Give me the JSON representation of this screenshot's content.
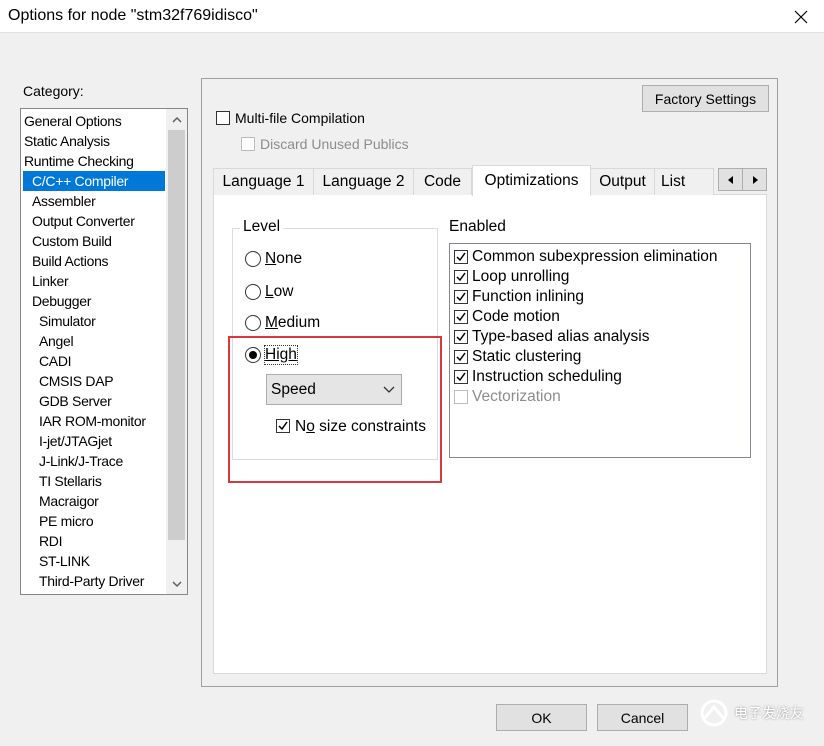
{
  "window": {
    "title": "Options for node \"stm32f769idisco\"",
    "close_glyph": "✕"
  },
  "category": {
    "label": "Category:",
    "items": [
      {
        "label": "General Options",
        "level": 0,
        "selected": false
      },
      {
        "label": "Static Analysis",
        "level": 0,
        "selected": false
      },
      {
        "label": "Runtime Checking",
        "level": 0,
        "selected": false
      },
      {
        "label": "C/C++ Compiler",
        "level": 1,
        "selected": true
      },
      {
        "label": "Assembler",
        "level": 1,
        "selected": false
      },
      {
        "label": "Output Converter",
        "level": 1,
        "selected": false
      },
      {
        "label": "Custom Build",
        "level": 1,
        "selected": false
      },
      {
        "label": "Build Actions",
        "level": 1,
        "selected": false
      },
      {
        "label": "Linker",
        "level": 1,
        "selected": false
      },
      {
        "label": "Debugger",
        "level": 1,
        "selected": false
      },
      {
        "label": "Simulator",
        "level": 2,
        "selected": false
      },
      {
        "label": "Angel",
        "level": 2,
        "selected": false
      },
      {
        "label": "CADI",
        "level": 2,
        "selected": false
      },
      {
        "label": "CMSIS DAP",
        "level": 2,
        "selected": false
      },
      {
        "label": "GDB Server",
        "level": 2,
        "selected": false
      },
      {
        "label": "IAR ROM-monitor",
        "level": 2,
        "selected": false
      },
      {
        "label": "I-jet/JTAGjet",
        "level": 2,
        "selected": false
      },
      {
        "label": "J-Link/J-Trace",
        "level": 2,
        "selected": false
      },
      {
        "label": "TI Stellaris",
        "level": 2,
        "selected": false
      },
      {
        "label": "Macraigor",
        "level": 2,
        "selected": false
      },
      {
        "label": "PE micro",
        "level": 2,
        "selected": false
      },
      {
        "label": "RDI",
        "level": 2,
        "selected": false
      },
      {
        "label": "ST-LINK",
        "level": 2,
        "selected": false
      },
      {
        "label": "Third-Party Driver",
        "level": 2,
        "selected": false
      }
    ]
  },
  "panel": {
    "factory_settings": "Factory Settings",
    "multifile": {
      "label": "Multi-file Compilation",
      "checked": false
    },
    "discard": {
      "label": "Discard Unused Publics",
      "checked": false,
      "enabled": false
    }
  },
  "tabs": [
    {
      "label": "Language 1",
      "active": false
    },
    {
      "label": "Language 2",
      "active": false
    },
    {
      "label": "Code",
      "active": false
    },
    {
      "label": "Optimizations",
      "active": true
    },
    {
      "label": "Output",
      "active": false
    },
    {
      "label": "List",
      "active": false
    }
  ],
  "level": {
    "title": "Level",
    "options": [
      {
        "label": "None",
        "hotkey": "N",
        "rest": "one",
        "selected": false
      },
      {
        "label": "Low",
        "hotkey": "L",
        "rest": "ow",
        "selected": false
      },
      {
        "label": "Medium",
        "hotkey": "M",
        "rest": "edium",
        "selected": false
      },
      {
        "label": "High",
        "hotkey": "",
        "rest": "High",
        "selected": true
      }
    ],
    "goal_select": {
      "value": "Speed"
    },
    "no_size": {
      "label_pre": "N",
      "label_hot": "o",
      "label_post": " size constraints",
      "checked": true
    }
  },
  "enabled": {
    "title": "Enabled",
    "items": [
      {
        "label": "Common subexpression elimination",
        "checked": true,
        "enabled": true
      },
      {
        "label": "Loop unrolling",
        "checked": true,
        "enabled": true
      },
      {
        "label": "Function inlining",
        "checked": true,
        "enabled": true
      },
      {
        "label": "Code motion",
        "checked": true,
        "enabled": true
      },
      {
        "label": "Type-based alias analysis",
        "checked": true,
        "enabled": true
      },
      {
        "label": "Static clustering",
        "checked": true,
        "enabled": true
      },
      {
        "label": "Instruction scheduling",
        "checked": true,
        "enabled": true
      },
      {
        "label": "Vectorization",
        "checked": false,
        "enabled": false
      }
    ]
  },
  "buttons": {
    "ok": "OK",
    "cancel": "Cancel"
  },
  "watermark": "电子发烧友",
  "colors": {
    "selection": "#0078d7",
    "highlight_box": "#d9393e"
  }
}
